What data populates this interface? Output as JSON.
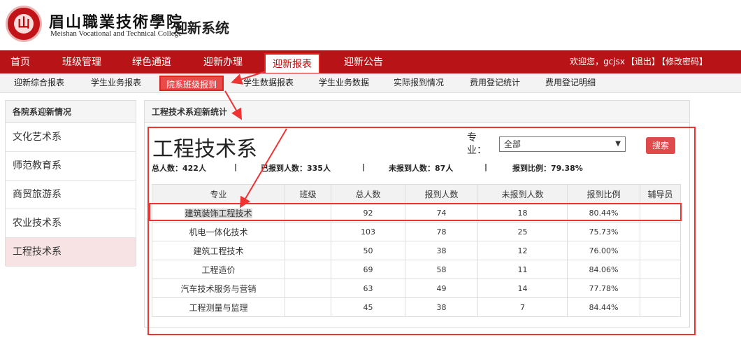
{
  "header": {
    "school_cn": "眉山職業技術學院",
    "school_en": "Meishan Vocational and Technical College",
    "system_name": "迎新系统"
  },
  "nav": {
    "items": [
      "首页",
      "班级管理",
      "绿色通道",
      "迎新办理",
      "迎新报表",
      "迎新公告"
    ],
    "user": {
      "greeting": "欢迎您，gcjsx",
      "logout": "【退出】",
      "change_pwd": "【修改密码】"
    }
  },
  "subnav": {
    "items": [
      "迎新综合报表",
      "学生业务报表",
      "院系班级报到",
      "学生数据报表",
      "学生业务数据",
      "实际报到情况",
      "费用登记统计",
      "费用登记明细"
    ]
  },
  "left": {
    "title": "各院系迎新情况",
    "items": [
      "文化艺术系",
      "师范教育系",
      "商贸旅游系",
      "农业技术系",
      "工程技术系"
    ]
  },
  "main": {
    "title": "工程技术系迎新统计",
    "dept": "工程技术系",
    "filter_label": "专业：",
    "select_value": "全部",
    "search": "搜索",
    "stats": {
      "total": "总人数：422人",
      "arrived": "已报到人数：335人",
      "not_arrived": "未报到人数：87人",
      "ratio": "报到比例：79.38%",
      "sep": "|"
    },
    "table": {
      "headers": [
        "专业",
        "班级",
        "总人数",
        "报到人数",
        "未报到人数",
        "报到比例",
        "辅导员"
      ],
      "rows": [
        [
          "建筑装饰工程技术",
          "",
          "92",
          "74",
          "18",
          "80.44%",
          ""
        ],
        [
          "机电一体化技术",
          "",
          "103",
          "78",
          "25",
          "75.73%",
          ""
        ],
        [
          "建筑工程技术",
          "",
          "50",
          "38",
          "12",
          "76.00%",
          ""
        ],
        [
          "工程造价",
          "",
          "69",
          "58",
          "11",
          "84.06%",
          ""
        ],
        [
          "汽车技术服务与营销",
          "",
          "63",
          "49",
          "14",
          "77.78%",
          ""
        ],
        [
          "工程测量与监理",
          "",
          "45",
          "38",
          "7",
          "84.44%",
          ""
        ]
      ]
    }
  },
  "colors": {
    "brand": "#b81417",
    "annotation": "#e33"
  }
}
